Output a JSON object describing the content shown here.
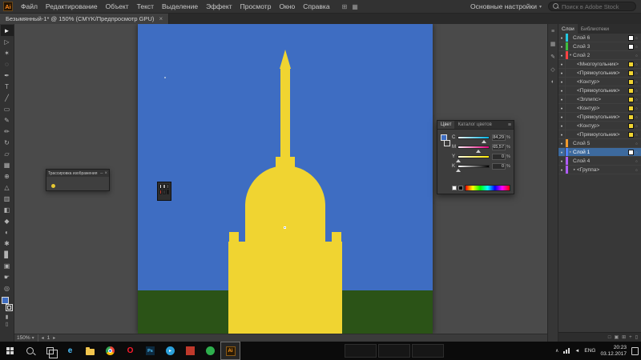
{
  "icons": {
    "close": "×",
    "minimize": "–",
    "chevron_down": "▾",
    "panel_menu": "≡",
    "eye": "●",
    "target": "○",
    "nav_prev": "◂",
    "nav_next": "▸",
    "tray_chevron": "∧",
    "volume": "◄"
  },
  "app": {
    "logo_text": "Ai"
  },
  "menubar": {
    "items": [
      "Файл",
      "Редактирование",
      "Объект",
      "Текст",
      "Выделение",
      "Эффект",
      "Просмотр",
      "Окно",
      "Справка"
    ],
    "extra_icons": [
      "⊞",
      "▦"
    ],
    "workspace_label": "Основные настройки",
    "search_placeholder": "Поиск в Adobe Stock"
  },
  "document_tab": {
    "title": "Безымянный-1* @ 150% (CMYK/Предпросмотр GPU)"
  },
  "toolbar": {
    "tools": [
      {
        "name": "selection",
        "glyph": "►"
      },
      {
        "name": "direct-selection",
        "glyph": "▷"
      },
      {
        "name": "magic-wand",
        "glyph": "✶"
      },
      {
        "name": "lasso",
        "glyph": "◌"
      },
      {
        "name": "pen",
        "glyph": "✒"
      },
      {
        "name": "type",
        "glyph": "T"
      },
      {
        "name": "line-segment",
        "glyph": "╱"
      },
      {
        "name": "rectangle",
        "glyph": "▭"
      },
      {
        "name": "paintbrush",
        "glyph": "✎"
      },
      {
        "name": "pencil",
        "glyph": "✏"
      },
      {
        "name": "rotate",
        "glyph": "↻"
      },
      {
        "name": "scale",
        "glyph": "▱"
      },
      {
        "name": "free-transform",
        "glyph": "▦"
      },
      {
        "name": "shape-builder",
        "glyph": "⊕"
      },
      {
        "name": "perspective-grid",
        "glyph": "△"
      },
      {
        "name": "mesh",
        "glyph": "▥"
      },
      {
        "name": "gradient",
        "glyph": "◧"
      },
      {
        "name": "eyedropper",
        "glyph": "◆"
      },
      {
        "name": "blend",
        "glyph": "◐"
      },
      {
        "name": "symbol-sprayer",
        "glyph": "✱"
      },
      {
        "name": "column-graph",
        "glyph": "▊"
      },
      {
        "name": "artboard",
        "glyph": "▣"
      },
      {
        "name": "hand",
        "glyph": "☛"
      },
      {
        "name": "zoom",
        "glyph": "◎"
      }
    ],
    "bottom_icons": [
      {
        "name": "draw-normal",
        "glyph": "▮"
      },
      {
        "name": "screen-mode",
        "glyph": "▯"
      }
    ]
  },
  "canvas": {
    "sky_color": "#3e6dc2",
    "ground_color": "#2b5317",
    "building_color": "#f0d431"
  },
  "floating": {
    "image_trace": {
      "title": "Трассировка изображения"
    },
    "mini_swatch": {
      "colors": [
        "#e8e8e8",
        "#a8a8a8",
        "#6a6a6a",
        "#c23a2e",
        "#303030",
        "#101010"
      ]
    },
    "color_panel": {
      "tabs": [
        {
          "label": "Цвет",
          "active": true
        },
        {
          "label": "Каталог цветов",
          "active": false
        }
      ],
      "unit": "%",
      "channels": [
        {
          "label": "C",
          "value": "84,29",
          "percent": 84
        },
        {
          "label": "M",
          "value": "65,57",
          "percent": 66
        },
        {
          "label": "Y",
          "value": "0",
          "percent": 0
        },
        {
          "label": "K",
          "value": "0",
          "percent": 0
        }
      ]
    }
  },
  "dock": {
    "icons": [
      {
        "name": "properties",
        "glyph": "≡"
      },
      {
        "name": "swatches",
        "glyph": "▦"
      },
      {
        "name": "brushes",
        "glyph": "✎"
      },
      {
        "name": "symbols",
        "glyph": "◇"
      },
      {
        "name": "appearance",
        "glyph": "◐"
      }
    ]
  },
  "layers_panel": {
    "tabs": [
      {
        "label": "Слои",
        "active": true
      },
      {
        "label": "Библиотеки",
        "active": false
      }
    ],
    "rows": [
      {
        "label": "Слой 6",
        "indent": 0,
        "color": "#23c8e0",
        "swatch": "#ffffff",
        "selected": false,
        "expand": ""
      },
      {
        "label": "Слой 3",
        "indent": 0,
        "color": "#3fbf3f",
        "swatch": "#ffffff",
        "selected": false,
        "expand": ""
      },
      {
        "label": "Слой 2",
        "indent": 0,
        "color": "#ff4343",
        "selected": false,
        "expand": "▾"
      },
      {
        "label": "<Многоугольник>",
        "indent": 1,
        "swatch": "#f0d431"
      },
      {
        "label": "<Прямоугольник>",
        "indent": 1,
        "swatch": "#f0d431"
      },
      {
        "label": "<Контур>",
        "indent": 1,
        "swatch": "#f0d431"
      },
      {
        "label": "<Прямоугольник>",
        "indent": 1,
        "swatch": "#f0d431"
      },
      {
        "label": "<Эллипс>",
        "indent": 1,
        "swatch": "#f0d431"
      },
      {
        "label": "<Контур>",
        "indent": 1,
        "swatch": "#f0d431"
      },
      {
        "label": "<Прямоугольник>",
        "indent": 1,
        "swatch": "#f0d431"
      },
      {
        "label": "<Контур>",
        "indent": 1,
        "swatch": "#f0d431"
      },
      {
        "label": "<Прямоугольник>",
        "indent": 1,
        "swatch": "#f0d431"
      },
      {
        "label": "Слой 5",
        "indent": 0,
        "color": "#f09a2e"
      },
      {
        "label": "Слой 1",
        "indent": 0,
        "color": "#4f82ff",
        "swatch": "#ffffff",
        "selected": true,
        "expand": "▸"
      },
      {
        "label": "Слой 4",
        "indent": 0,
        "color": "#b05cff"
      },
      {
        "label": "<Группа>",
        "indent": 1,
        "color": "#b05cff",
        "expand": "▸"
      }
    ],
    "footer_icons": [
      {
        "name": "collect-for-export",
        "glyph": "□"
      },
      {
        "name": "make-mask",
        "glyph": "▣"
      },
      {
        "name": "new-sublayer",
        "glyph": "⊞"
      },
      {
        "name": "new-layer",
        "glyph": "+"
      },
      {
        "name": "delete-layer",
        "glyph": "▯"
      }
    ]
  },
  "statusbar": {
    "zoom": "150%",
    "artboard_number": "1"
  },
  "taskbar": {
    "apps": [
      {
        "name": "edge",
        "glyph": "e",
        "style": "plain",
        "color": "#4cc2ff"
      },
      {
        "name": "file-explorer",
        "glyph": "",
        "style": "folder",
        "color": "#f3c64e"
      },
      {
        "name": "chrome",
        "glyph": "",
        "style": "chrome",
        "color": ""
      },
      {
        "name": "opera",
        "glyph": "O",
        "style": "plain",
        "color": "#ff1b2d"
      },
      {
        "name": "photoshop",
        "glyph": "Ps",
        "style": "square",
        "color": "#0d2a3f",
        "fg": "#4cc2ff"
      },
      {
        "name": "telegram",
        "glyph": "▸",
        "style": "circle",
        "color": "#2ba0da"
      },
      {
        "name": "red-app",
        "glyph": "",
        "style": "square",
        "color": "#c0392b"
      },
      {
        "name": "green-app",
        "glyph": "",
        "style": "circle",
        "color": "#2eaf4d"
      },
      {
        "name": "illustrator",
        "glyph": "Ai",
        "style": "ai",
        "color": "#ff9a1e",
        "active": true
      }
    ],
    "lang": "ENG",
    "time": "20:23",
    "date": "03.12.2017"
  }
}
